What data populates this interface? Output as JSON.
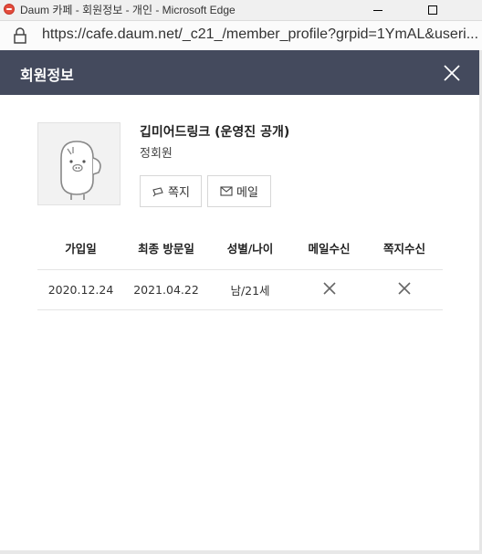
{
  "window": {
    "title": "Daum 카페 - 회원정보 - 개인 - Microsoft Edge"
  },
  "address_bar": {
    "url": "https://cafe.daum.net/_c21_/member_profile?grpid=1YmAL&useri..."
  },
  "modal": {
    "title": "회원정보"
  },
  "profile": {
    "nickname": "깁미어드링크 (운영진 공개)",
    "grade": "정회원"
  },
  "actions": {
    "note_label": "쪽지",
    "mail_label": "메일"
  },
  "info_table": {
    "headers": [
      "가입일",
      "최종 방문일",
      "성별/나이",
      "메일수신",
      "쪽지수신"
    ],
    "values": {
      "joined": "2020.12.24",
      "last_visit": "2021.04.22",
      "gender_age": "남/21세",
      "mail_receive": "none",
      "note_receive": "none"
    }
  },
  "colors": {
    "header_bg": "#444a5d",
    "page_bg": "#ffffff"
  },
  "icons": {
    "app": "daum-app-icon",
    "lock": "lock-icon",
    "close": "close-icon",
    "note": "note-icon",
    "mail": "mail-icon",
    "not_allowed": "x-icon"
  }
}
